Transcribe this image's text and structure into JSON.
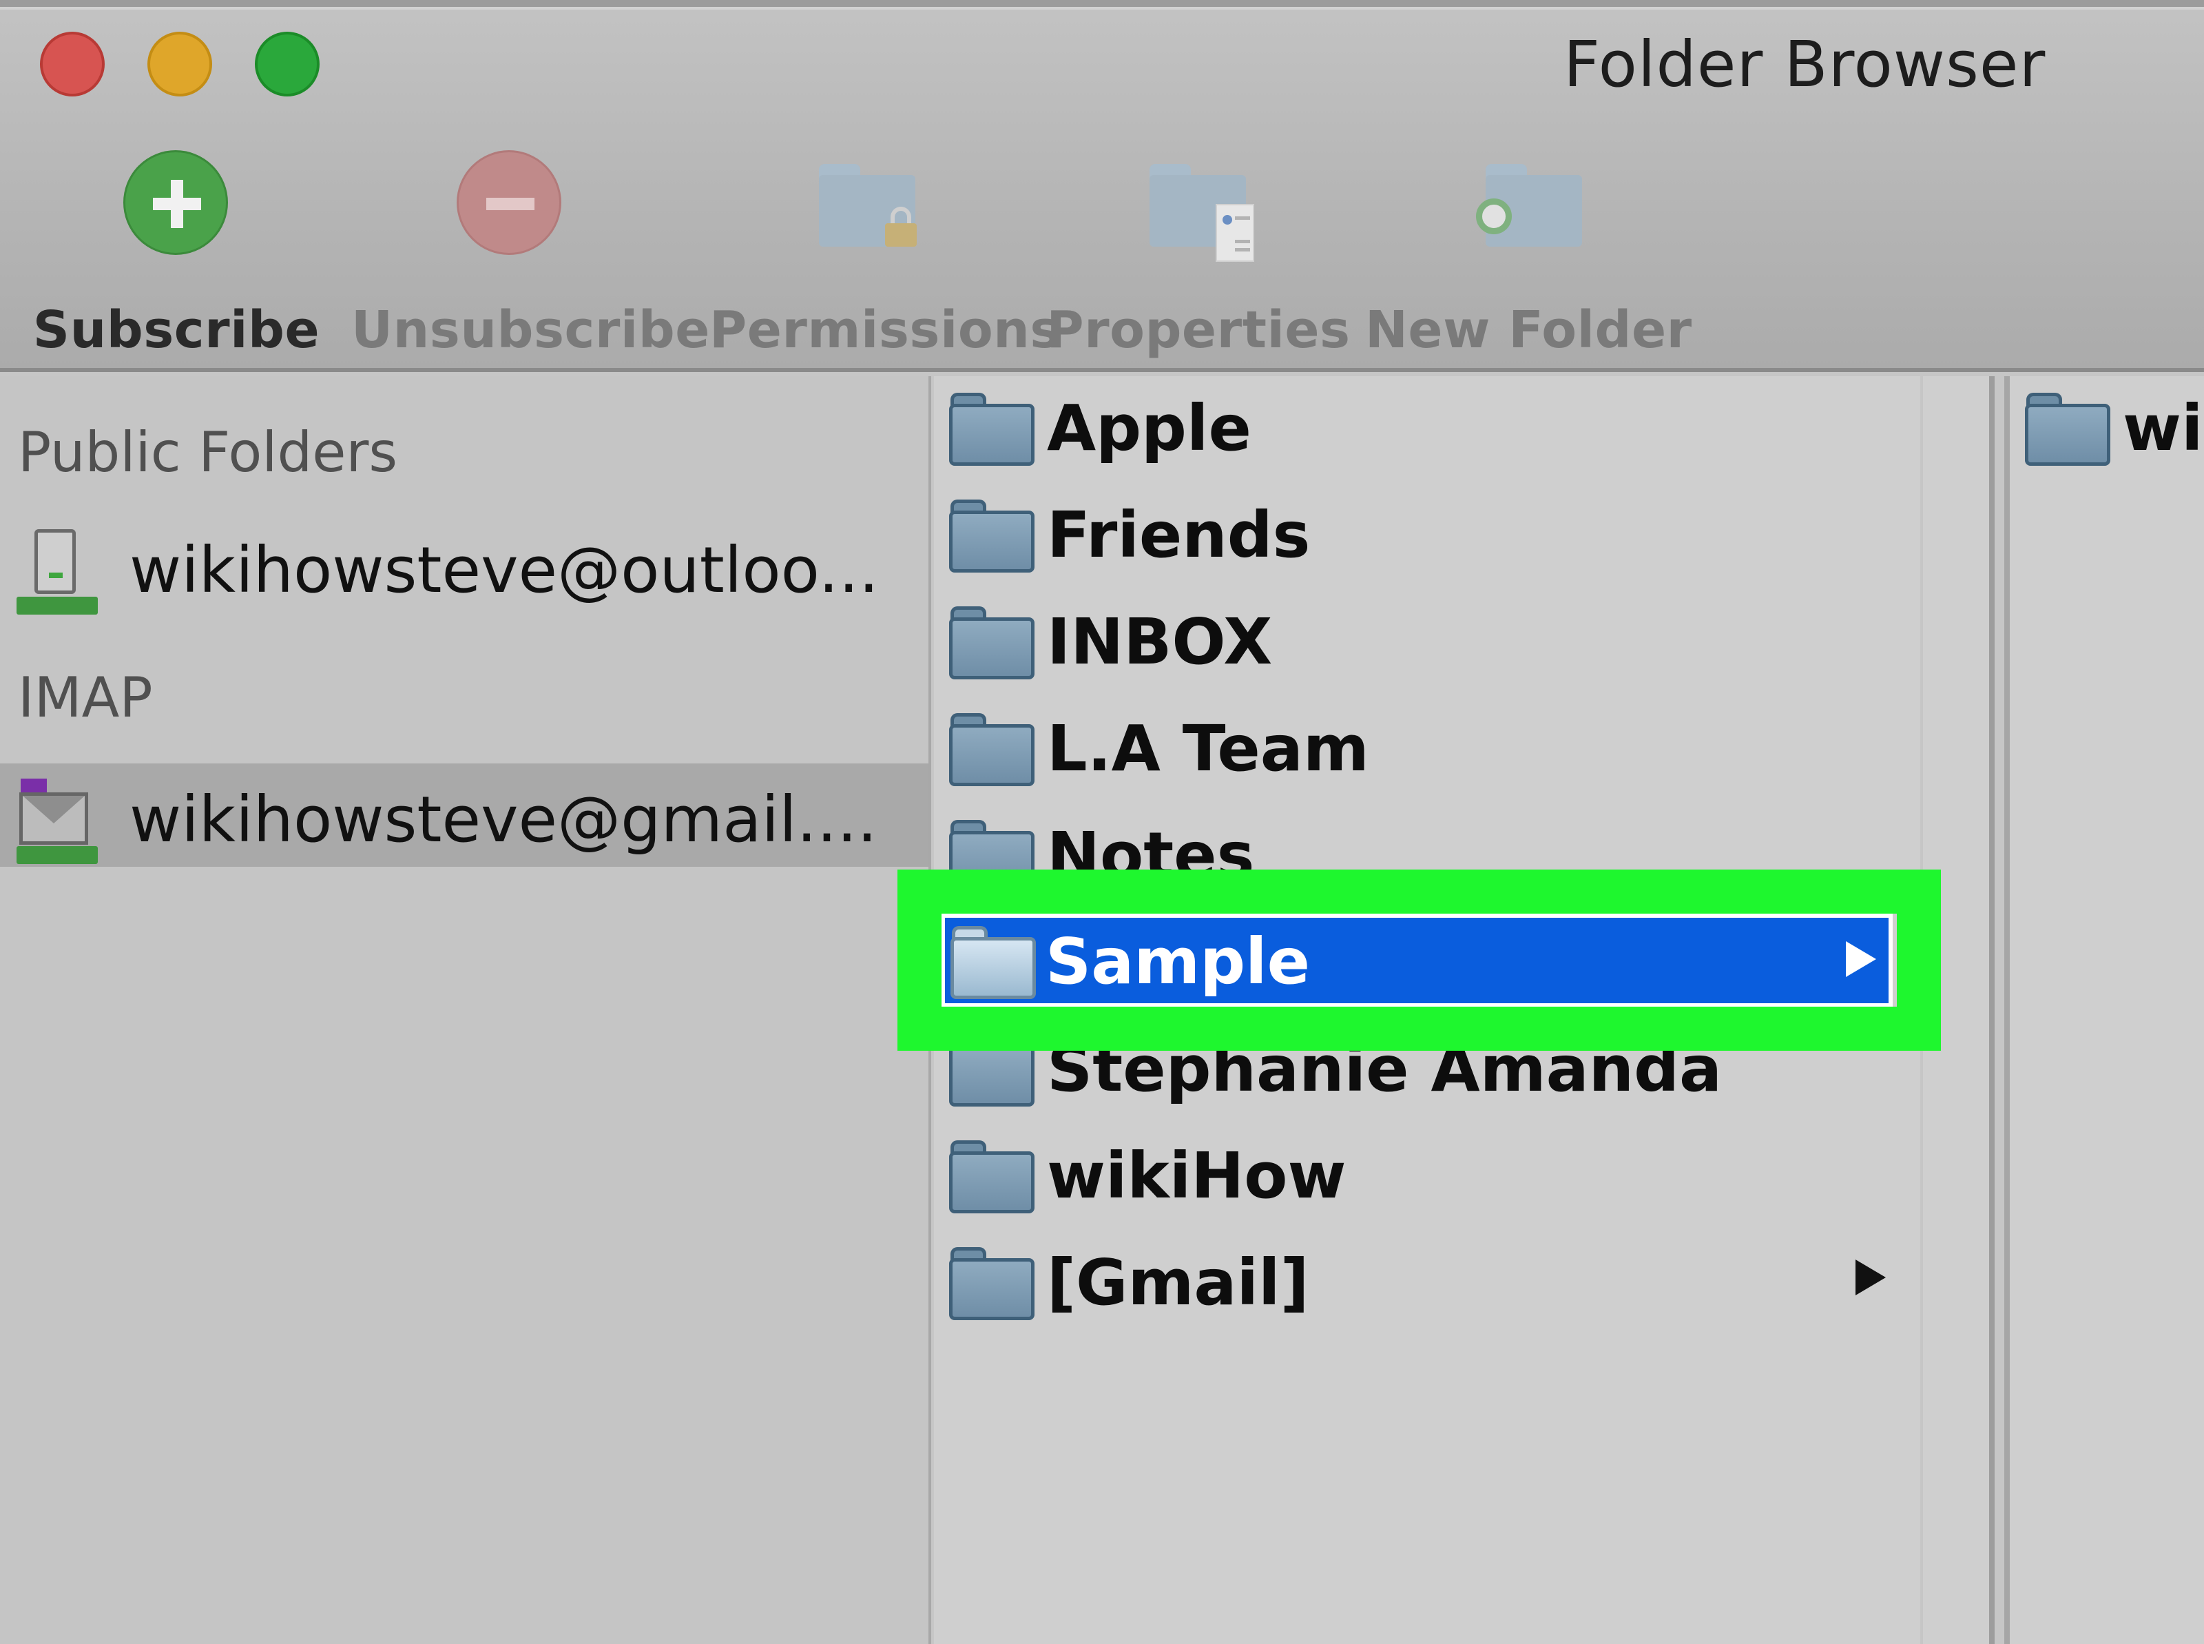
{
  "window": {
    "title": "Folder Browser",
    "controls": [
      "close",
      "minimize",
      "zoom"
    ]
  },
  "toolbar": {
    "items": [
      {
        "label": "Subscribe",
        "icon": "plus-circle-icon",
        "enabled": true
      },
      {
        "label": "Unsubscribe",
        "icon": "minus-circle-icon",
        "enabled": false
      },
      {
        "label": "Permissions",
        "icon": "folder-lock-icon",
        "enabled": false
      },
      {
        "label": "Properties",
        "icon": "folder-properties-icon",
        "enabled": false
      },
      {
        "label": "New Folder",
        "icon": "new-folder-icon",
        "enabled": false
      }
    ]
  },
  "sidebar": {
    "sections": [
      {
        "label": "Public Folders",
        "accounts": [
          {
            "name": "wikihowsteve@outloo...",
            "icon": "server-icon",
            "selected": false
          }
        ]
      },
      {
        "label": "IMAP",
        "accounts": [
          {
            "name": "wikihowsteve@gmail....",
            "icon": "mail-server-icon",
            "selected": true
          }
        ]
      }
    ]
  },
  "folders": {
    "items": [
      {
        "name": "Apple",
        "has_children": false,
        "selected": false
      },
      {
        "name": "Friends",
        "has_children": false,
        "selected": false
      },
      {
        "name": "INBOX",
        "has_children": false,
        "selected": false
      },
      {
        "name": "L.A Team",
        "has_children": false,
        "selected": false
      },
      {
        "name": "Notes",
        "has_children": false,
        "selected": false
      },
      {
        "name": "Sample",
        "has_children": true,
        "selected": true
      },
      {
        "name": "Stephanie Amanda",
        "has_children": false,
        "selected": false
      },
      {
        "name": "wikiHow",
        "has_children": false,
        "selected": false
      },
      {
        "name": "[Gmail]",
        "has_children": true,
        "selected": false
      }
    ]
  },
  "subfolders": {
    "items": [
      {
        "name": "wikiHow"
      }
    ]
  },
  "colors": {
    "selection": "#0a5ddd",
    "highlight_annotation": "#1ef72e",
    "close": "#d75451",
    "minimize": "#dfa62a",
    "zoom": "#2aa83b"
  }
}
